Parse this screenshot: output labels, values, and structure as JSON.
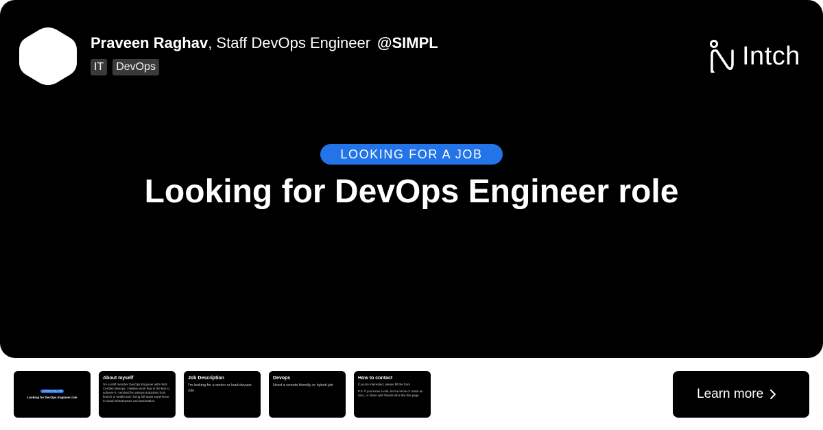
{
  "author": {
    "name": "Praveen Raghav",
    "role": ", Staff DevOps Engineer",
    "company": "@SIMPL",
    "tags": [
      "IT",
      "DevOps"
    ]
  },
  "brand": {
    "name": "Intch",
    "icon": "intch-logo-icon"
  },
  "post": {
    "category": "LOOKING FOR A JOB",
    "title": "Looking for DevOps Engineer role"
  },
  "slides": [
    {
      "title": "",
      "body": [],
      "cover_pill": "LOOKING FOR A JOB",
      "cover_title": "Looking for DevOps Engineer role"
    },
    {
      "title": "About myself",
      "body": [
        "I'm a staff member DevOps Engineer with AWS Certified devops. I believe work flow is the key to achieve it. I worked for various industries from fintech to health and I bring full-stack experience in cloud infrastructure and automation."
      ]
    },
    {
      "title": "Job Description",
      "body": [
        "I'm looking for a senior or lead devops role"
      ]
    },
    {
      "title": "Devops",
      "body": [
        "Need a remote friendly or hybrid job"
      ]
    },
    {
      "title": "How to contact",
      "body": [
        "If you're interested, please fill the form",
        "P.S. If you know a role, let me know or make an intro, or share with friends who like this page"
      ]
    }
  ],
  "cta": {
    "label": "Learn more",
    "icon": "chevron-right-icon"
  },
  "colors": {
    "background": "#000000",
    "accent": "#2374e8",
    "tag_bg": "#3a3a3a"
  }
}
